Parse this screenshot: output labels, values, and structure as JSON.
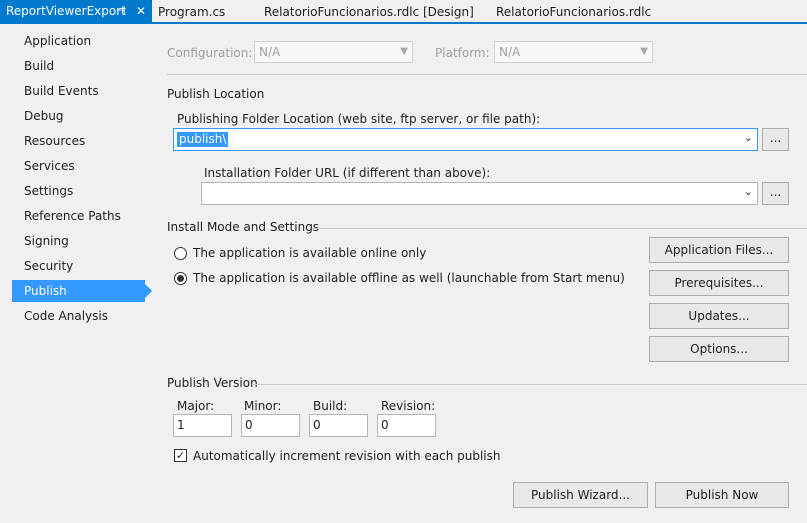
{
  "tabs": [
    {
      "label": "ReportViewerExport",
      "active": true
    },
    {
      "label": "Program.cs"
    },
    {
      "label": "RelatorioFuncionarios.rdlc [Design]"
    },
    {
      "label": "RelatorioFuncionarios.rdlc"
    }
  ],
  "tab_pin_icon": "pin-icon",
  "tab_close_icon": "close-icon",
  "sidebar": {
    "items": [
      {
        "label": "Application"
      },
      {
        "label": "Build"
      },
      {
        "label": "Build Events"
      },
      {
        "label": "Debug"
      },
      {
        "label": "Resources"
      },
      {
        "label": "Services"
      },
      {
        "label": "Settings"
      },
      {
        "label": "Reference Paths"
      },
      {
        "label": "Signing"
      },
      {
        "label": "Security"
      },
      {
        "label": "Publish",
        "selected": true
      },
      {
        "label": "Code Analysis"
      }
    ]
  },
  "config": {
    "configuration_label": "Configuration:",
    "configuration_value": "N/A",
    "platform_label": "Platform:",
    "platform_value": "N/A"
  },
  "publish_location": {
    "section_title": "Publish Location",
    "folder_label": "Publishing Folder Location (web site, ftp server, or file path):",
    "folder_value": "publish\\",
    "browse_label": "...",
    "install_label": "Installation Folder URL (if different than above):",
    "install_value": "",
    "install_browse_label": "..."
  },
  "install_mode": {
    "section_title": "Install Mode and Settings",
    "option_online": "The application is available online only",
    "option_offline": "The application is available offline as well (launchable from Start menu)",
    "selected": "offline",
    "buttons": {
      "application_files": "Application Files...",
      "prerequisites": "Prerequisites...",
      "updates": "Updates...",
      "options": "Options..."
    }
  },
  "publish_version": {
    "section_title": "Publish Version",
    "major_label": "Major:",
    "major_value": "1",
    "minor_label": "Minor:",
    "minor_value": "0",
    "build_label": "Build:",
    "build_value": "0",
    "revision_label": "Revision:",
    "revision_value": "0",
    "auto_increment_label": "Automatically increment revision with each publish",
    "auto_increment_checked": true
  },
  "actions": {
    "wizard_label": "Publish Wizard...",
    "publish_now_label": "Publish Now"
  }
}
